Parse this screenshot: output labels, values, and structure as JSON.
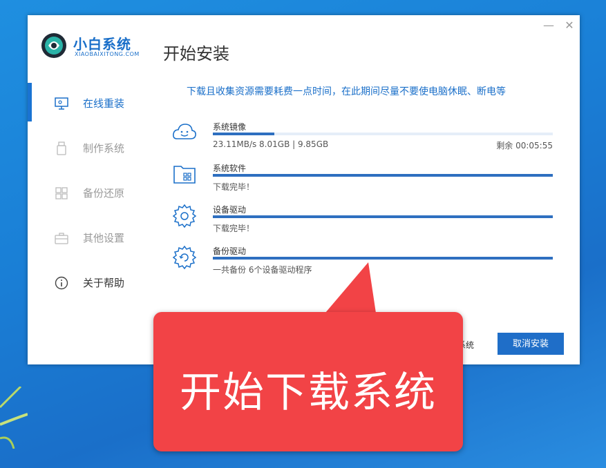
{
  "window": {
    "min_label": "—",
    "close_label": "✕"
  },
  "logo": {
    "title": "小白系统",
    "subtitle": "XIAOBAIXITONG.COM"
  },
  "page_title": "开始安装",
  "sidebar": {
    "items": [
      {
        "label": "在线重装",
        "icon": "monitor-icon",
        "state": "active"
      },
      {
        "label": "制作系统",
        "icon": "usb-icon",
        "state": "disabled"
      },
      {
        "label": "备份还原",
        "icon": "backup-icon",
        "state": "disabled"
      },
      {
        "label": "其他设置",
        "icon": "briefcase-icon",
        "state": "disabled"
      },
      {
        "label": "关于帮助",
        "icon": "info-icon",
        "state": "normal"
      }
    ]
  },
  "notice": "下载且收集资源需要耗费一点时间，在此期间尽量不要使电脑休眠、断电等",
  "tasks": [
    {
      "name": "系统镜像",
      "status": "23.11MB/s 8.01GB | 9.85GB",
      "right": "剩余 00:05:55",
      "progress": 0.18,
      "icon": "cloud-smile-icon"
    },
    {
      "name": "系统软件",
      "status": "下载完毕！",
      "right": "",
      "progress": 1.0,
      "icon": "folder-apps-icon"
    },
    {
      "name": "设备驱动",
      "status": "下载完毕！",
      "right": "",
      "progress": 1.0,
      "icon": "gear-icon"
    },
    {
      "name": "备份驱动",
      "status": "一共备份 6个设备驱动程序",
      "right": "",
      "progress": 1.0,
      "icon": "gear-backup-icon"
    }
  ],
  "footer": {
    "partial_link": "选系统",
    "cancel_label": "取消安装"
  },
  "callout": {
    "text": "开始下载系统"
  },
  "colors": {
    "accent": "#1a6fc9",
    "progress": "#2e6fc0",
    "callout": "#f24346"
  }
}
